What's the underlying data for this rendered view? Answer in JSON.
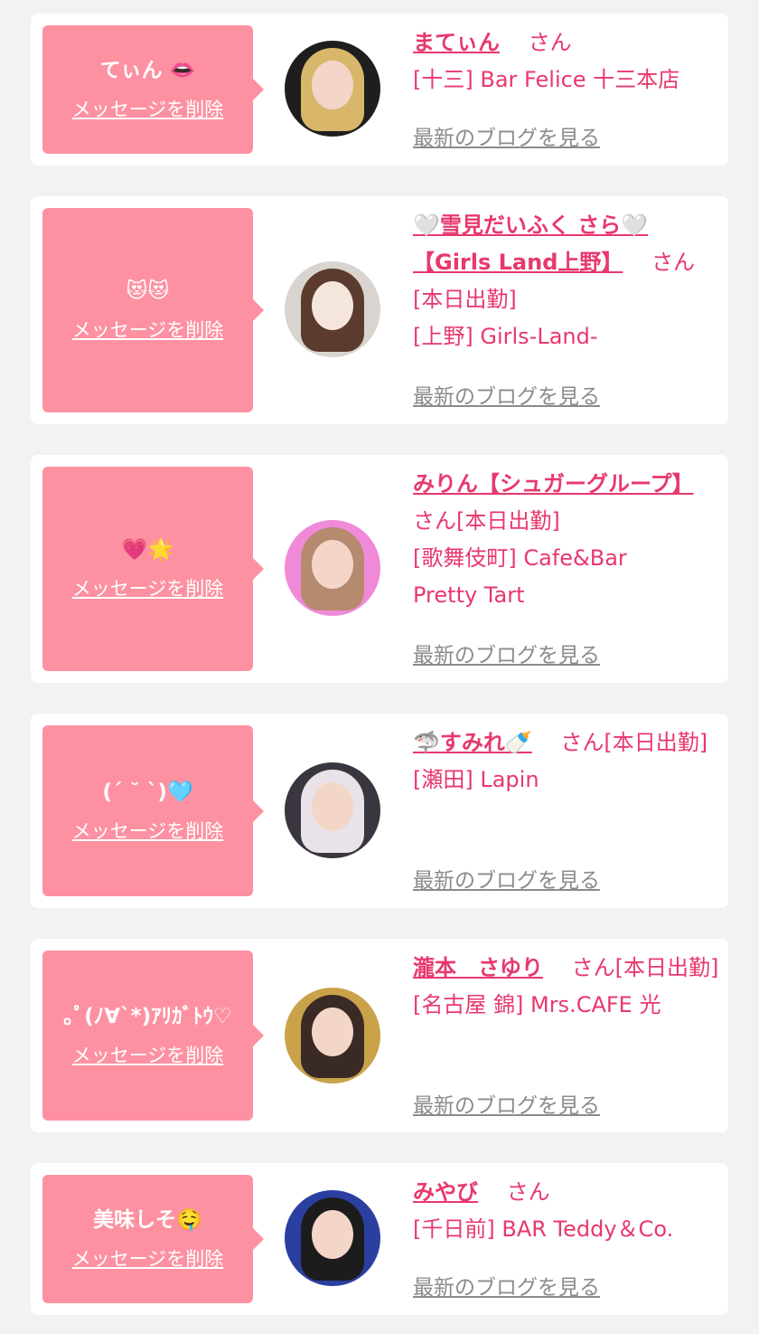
{
  "common": {
    "delete_label": "メッセージを削除",
    "san": "さん",
    "blog_label": "最新のブログを見る"
  },
  "colors": {
    "accent": "#e8386d",
    "bubble": "#fd91a1",
    "background": "#f2f2f2",
    "card": "#ffffff",
    "muted": "#8b8b8b"
  },
  "entries": [
    {
      "message": "てぃん 👄",
      "name": "まてぃん",
      "after_name": "",
      "lines": [
        "[十三] Bar Felice 十三本店"
      ]
    },
    {
      "message": "😻😻",
      "name": "🤍雪見だいふく さら🤍【Girls Land上野】",
      "after_name": "",
      "lines": [
        "[本日出勤]",
        "[上野] Girls-Land-"
      ]
    },
    {
      "message": "💗🌟",
      "name": "みりん【シュガーグループ】",
      "after_name": "[本日出勤]",
      "lines": [
        "[歌舞伎町] Cafe&Bar",
        "Pretty Tart"
      ]
    },
    {
      "message": "(ˊ ˘ ˋ)🩵",
      "name": "🦈すみれ🍼",
      "after_name": "[本日出勤]",
      "lines": [
        "[瀬田] Lapin"
      ]
    },
    {
      "message": "｡ﾟ(ﾉ∀`*)ｱﾘｶﾞﾄｳ♡",
      "name": "瀧本　さゆり",
      "after_name": "[本日出勤]",
      "lines": [
        "[名古屋 錦] Mrs.CAFE 光"
      ]
    },
    {
      "message": "美味しそ🤤",
      "name": "みやび",
      "after_name": "",
      "lines": [
        "[千日前] BAR Teddy＆Co."
      ]
    }
  ]
}
